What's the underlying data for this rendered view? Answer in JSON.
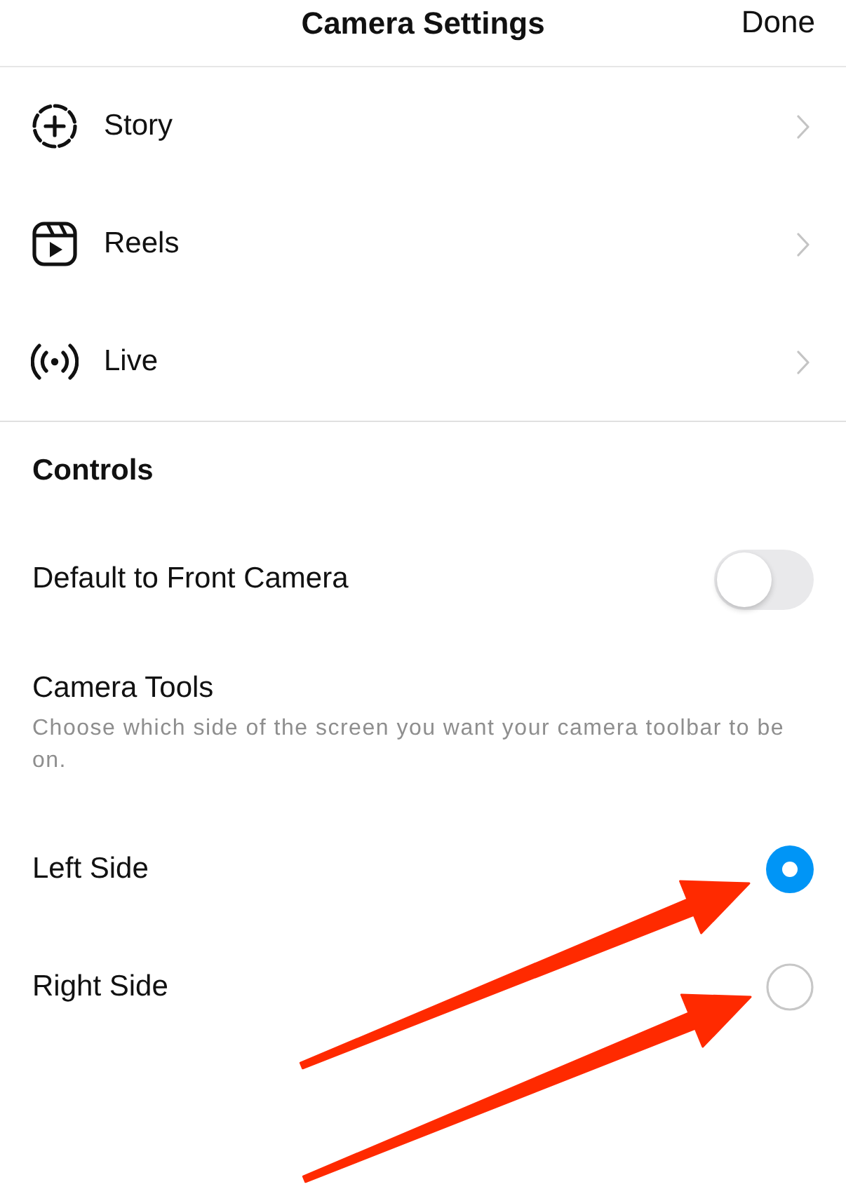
{
  "header": {
    "title": "Camera Settings",
    "done": "Done"
  },
  "nav_items": [
    {
      "kind": "story",
      "label": "Story"
    },
    {
      "kind": "reels",
      "label": "Reels"
    },
    {
      "kind": "live",
      "label": "Live"
    }
  ],
  "controls": {
    "heading": "Controls",
    "front_camera": {
      "label": "Default to Front Camera",
      "on": false
    },
    "camera_tools": {
      "title": "Camera Tools",
      "description": "Choose which side of the screen you want your camera toolbar to be on.",
      "options": [
        {
          "label": "Left Side",
          "selected": true
        },
        {
          "label": "Right Side",
          "selected": false
        }
      ]
    }
  }
}
